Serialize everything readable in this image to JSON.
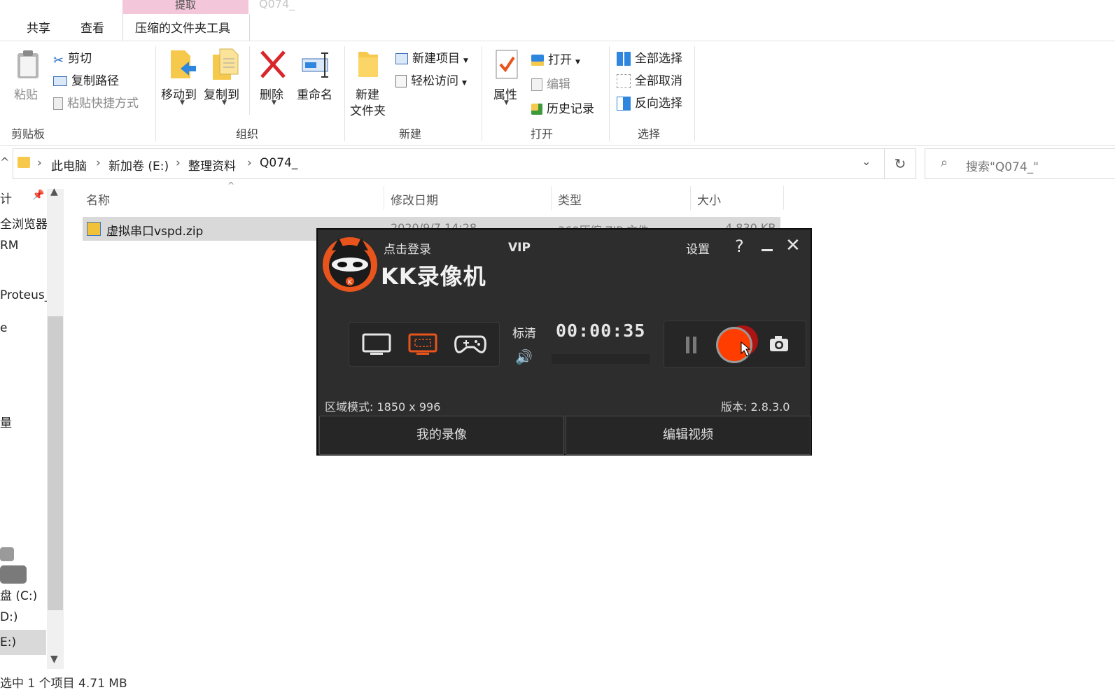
{
  "ribbon_tabs": {
    "context_label": "提取",
    "ghost_title": "Q074_",
    "share": "共享",
    "view": "查看",
    "compressed_tools": "压缩的文件夹工具"
  },
  "clipboard": {
    "paste": "粘贴",
    "cut": "剪切",
    "copy_path": "复制路径",
    "paste_shortcut": "粘贴快捷方式",
    "group": "剪贴板"
  },
  "organize": {
    "move_to": "移动到",
    "copy_to": "复制到",
    "delete": "删除",
    "rename": "重命名",
    "group": "组织"
  },
  "new": {
    "new_folder_line1": "新建",
    "new_folder_line2": "文件夹",
    "new_item": "新建项目",
    "easy_access": "轻松访问",
    "group": "新建"
  },
  "open": {
    "properties": "属性",
    "open": "打开",
    "edit": "编辑",
    "history": "历史记录",
    "group": "打开"
  },
  "select": {
    "select_all": "全部选择",
    "select_none": "全部取消",
    "invert": "反向选择",
    "group": "选择"
  },
  "address": {
    "crumbs": [
      "此电脑",
      "新加卷 (E:)",
      "整理资料",
      "Q074_"
    ],
    "search_placeholder": "搜索\"Q074_\""
  },
  "nav_items": [
    "计",
    "全浏览器",
    "RM",
    "Proteus_",
    "e",
    "量",
    "盘 (C:)",
    "D:)",
    "E:)"
  ],
  "columns": {
    "name": "名称",
    "date": "修改日期",
    "type": "类型",
    "size": "大小"
  },
  "files": [
    {
      "name": "虚拟串口vspd.zip",
      "date": "2020/9/7 14:28",
      "type": "360压缩 ZIP 文件",
      "size": "4,830 KB"
    }
  ],
  "status_bar": "选中 1 个项目  4.71 MB",
  "kk": {
    "login": "点击登录",
    "vip": "VIP",
    "settings": "设置",
    "help": "?",
    "title": "KK录像机",
    "quality": "标清",
    "timer": "00:00:35",
    "region_mode": "区域模式: 1850 x 996",
    "version": "版本: 2.8.3.0",
    "my_recordings": "我的录像",
    "edit_video": "编辑视频"
  },
  "colors": {
    "accent": "#e8541c",
    "record_red": "#ff3d00",
    "kk_bg": "#2d2d2d"
  }
}
